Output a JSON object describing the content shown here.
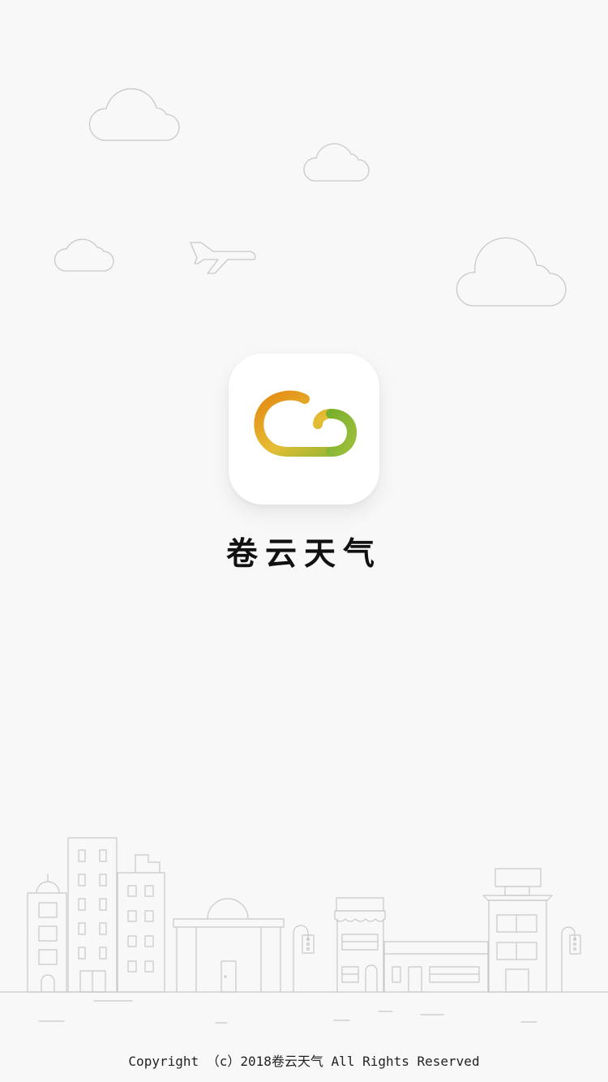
{
  "app": {
    "name": "卷云天气",
    "copyright": "Copyright （c）2018卷云天气 All Rights Reserved"
  },
  "icons": {
    "logo": "cloud-logo-icon",
    "plane": "airplane-icon",
    "clouds": "cloud-outline-icon",
    "city": "cityscape-illustration"
  },
  "colors": {
    "background": "#f8f8f8",
    "line_art": "#c8c8c8",
    "logo_orange": "#e48a12",
    "logo_yellow": "#e5bd35",
    "logo_green": "#86b534"
  }
}
